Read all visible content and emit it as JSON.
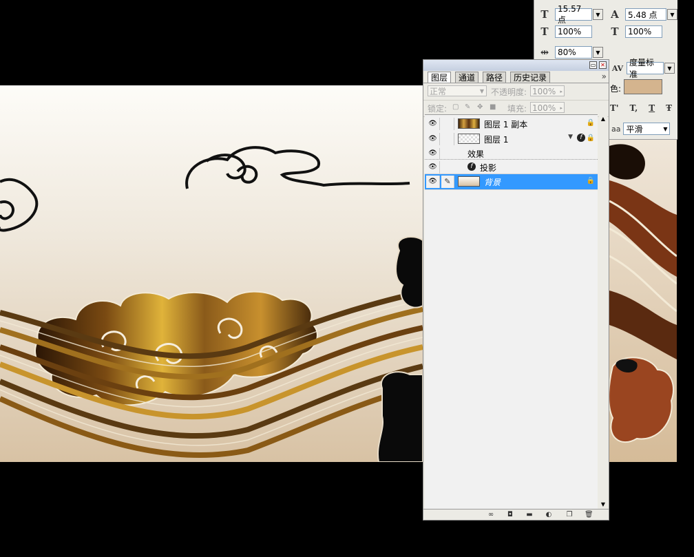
{
  "character_panel": {
    "font_size": "15.57 点",
    "leading": "5.48 点",
    "vertical_scale": "100%",
    "horizontal_scale": "100%",
    "tracking": "80%",
    "kerning": "度量标准",
    "color_label": "色:",
    "color_swatch": "#d4b48e",
    "baseline_icons": [
      "T'",
      "T,",
      "T",
      "Ŧ"
    ],
    "antialias_label": "aa",
    "antialias": "平滑"
  },
  "layers_panel": {
    "tabs": [
      "图层",
      "通道",
      "路径",
      "历史记录"
    ],
    "menu_icon": "»",
    "blend_mode": "正常",
    "opacity_label": "不透明度:",
    "opacity": "100%",
    "lock_label": "锁定:",
    "fill_label": "填充:",
    "fill": "100%",
    "layers": [
      {
        "name": "图层 1 副本"
      },
      {
        "name": "图层 1"
      },
      {
        "name": "背景"
      }
    ],
    "effects_label": "效果",
    "effect_item": "投影",
    "fx_icon": "f",
    "selected_layer": "背景"
  }
}
